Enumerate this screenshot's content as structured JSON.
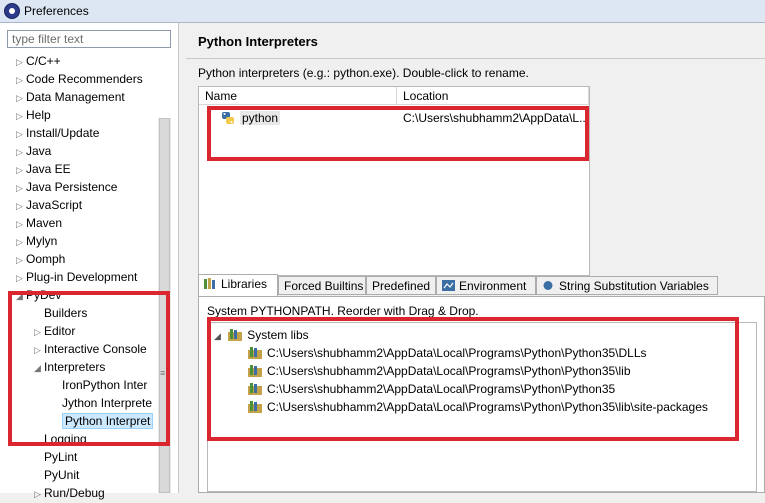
{
  "window": {
    "title": "Preferences"
  },
  "sidebar": {
    "filter_placeholder": "type filter text",
    "items": [
      {
        "label": "C/C++",
        "expander": "▷"
      },
      {
        "label": "Code Recommenders",
        "expander": "▷"
      },
      {
        "label": "Data Management",
        "expander": "▷"
      },
      {
        "label": "Help",
        "expander": "▷"
      },
      {
        "label": "Install/Update",
        "expander": "▷"
      },
      {
        "label": "Java",
        "expander": "▷"
      },
      {
        "label": "Java EE",
        "expander": "▷"
      },
      {
        "label": "Java Persistence",
        "expander": "▷"
      },
      {
        "label": "JavaScript",
        "expander": "▷"
      },
      {
        "label": "Maven",
        "expander": "▷"
      },
      {
        "label": "Mylyn",
        "expander": "▷"
      },
      {
        "label": "Oomph",
        "expander": "▷"
      },
      {
        "label": "Plug-in Development",
        "expander": "▷"
      },
      {
        "label": "PyDev",
        "expander": "◢"
      },
      {
        "label": "Builders",
        "expander": ""
      },
      {
        "label": "Editor",
        "expander": "▷"
      },
      {
        "label": "Interactive Console",
        "expander": "▷"
      },
      {
        "label": "Interpreters",
        "expander": "◢"
      },
      {
        "label": "IronPython Inter",
        "expander": ""
      },
      {
        "label": "Jython Interprete",
        "expander": ""
      },
      {
        "label": "Python Interpret",
        "expander": ""
      },
      {
        "label": "Logging",
        "expander": ""
      },
      {
        "label": "PyLint",
        "expander": ""
      },
      {
        "label": "PyUnit",
        "expander": ""
      },
      {
        "label": "Run/Debug",
        "expander": "▷"
      }
    ],
    "selected_index": 20
  },
  "main": {
    "title": "Python Interpreters",
    "description": "Python interpreters (e.g.: python.exe).   Double-click to rename.",
    "table": {
      "columns": [
        "Name",
        "Location"
      ],
      "rows": [
        {
          "name": "python",
          "location": "C:\\Users\\shubhamm2\\AppData\\L..."
        }
      ]
    },
    "tabs": [
      {
        "label": "Libraries",
        "icon": "libraries-icon",
        "active": true
      },
      {
        "label": "Forced Builtins",
        "icon": "",
        "active": false
      },
      {
        "label": "Predefined",
        "icon": "",
        "active": false
      },
      {
        "label": "Environment",
        "icon": "environment-icon",
        "active": false
      },
      {
        "label": "String Substitution Variables",
        "icon": "variables-icon",
        "active": false
      }
    ],
    "libraries": {
      "hint": "System PYTHONPATH.   Reorder with Drag & Drop.",
      "group_label": "System libs",
      "paths": [
        "C:\\Users\\shubhamm2\\AppData\\Local\\Programs\\Python\\Python35\\DLLs",
        "C:\\Users\\shubhamm2\\AppData\\Local\\Programs\\Python\\Python35\\lib",
        "C:\\Users\\shubhamm2\\AppData\\Local\\Programs\\Python\\Python35",
        "C:\\Users\\shubhamm2\\AppData\\Local\\Programs\\Python\\Python35\\lib\\site-packages"
      ]
    }
  },
  "colors": {
    "highlight": "#d9262f",
    "selection": "#cce8ff"
  }
}
